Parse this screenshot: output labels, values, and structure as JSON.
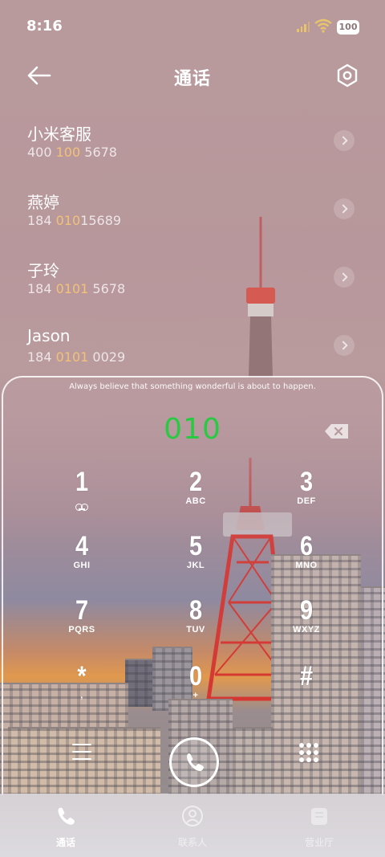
{
  "status_bar": {
    "time": "8:16",
    "battery": "100"
  },
  "header": {
    "title": "通话"
  },
  "calls": [
    {
      "name": "小米客服",
      "number_pre": "400 ",
      "number_hl": "100",
      "number_post": " 5678"
    },
    {
      "name": "燕婷",
      "number_pre": "184 ",
      "number_hl": "010",
      "number_post": "15689"
    },
    {
      "name": "子玲",
      "number_pre": "184 ",
      "number_hl": "0101",
      "number_post": " 5678"
    },
    {
      "name": "Jason",
      "number_pre": "184 ",
      "number_hl": "0101",
      "number_post": " 0029"
    }
  ],
  "dialer": {
    "quote": "Always believe that something wonderful is about to happen.",
    "number": "010",
    "keys": [
      {
        "digit": "1",
        "letters": ""
      },
      {
        "digit": "2",
        "letters": "ABC"
      },
      {
        "digit": "3",
        "letters": "DEF"
      },
      {
        "digit": "4",
        "letters": "GHI"
      },
      {
        "digit": "5",
        "letters": "JKL"
      },
      {
        "digit": "6",
        "letters": "MNO"
      },
      {
        "digit": "7",
        "letters": "PQRS"
      },
      {
        "digit": "8",
        "letters": "TUV"
      },
      {
        "digit": "9",
        "letters": "WXYZ"
      },
      {
        "digit": "*",
        "letters": ","
      },
      {
        "digit": "0",
        "letters": "+"
      },
      {
        "digit": "#",
        "letters": ""
      }
    ]
  },
  "bottom_nav": [
    {
      "label": "通话",
      "icon": "phone-icon",
      "active": true
    },
    {
      "label": "联系人",
      "icon": "contacts-icon",
      "active": false
    },
    {
      "label": "营业厅",
      "icon": "store-icon",
      "active": false
    }
  ],
  "colors": {
    "accent_green": "#2ac942",
    "highlight": "#f2c27a"
  }
}
